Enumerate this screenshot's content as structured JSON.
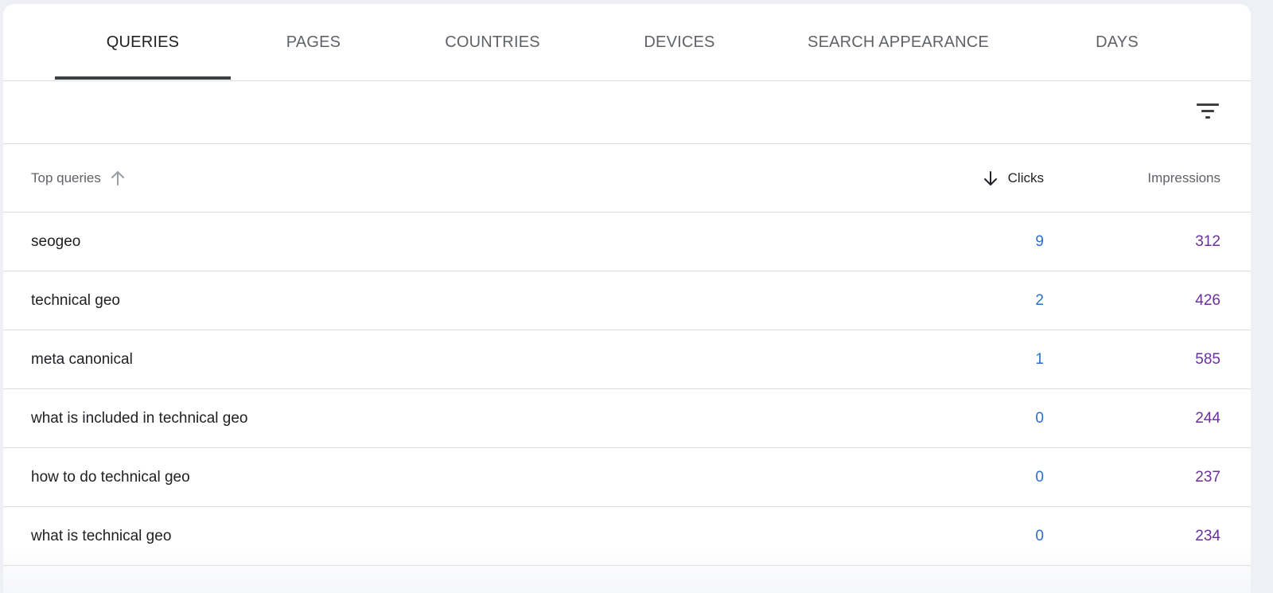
{
  "tabs": [
    {
      "label": "QUERIES",
      "active": true
    },
    {
      "label": "PAGES",
      "active": false
    },
    {
      "label": "COUNTRIES",
      "active": false
    },
    {
      "label": "DEVICES",
      "active": false
    },
    {
      "label": "SEARCH APPEARANCE",
      "active": false
    },
    {
      "label": "DAYS",
      "active": false
    }
  ],
  "toolbar": {
    "filter_icon": "filter-icon"
  },
  "table": {
    "columns": {
      "query": "Top queries",
      "clicks": "Clicks",
      "impressions": "Impressions"
    },
    "sort": {
      "query_icon": "arrow-up-icon",
      "clicks_icon": "arrow-down-icon"
    },
    "rows": [
      {
        "query": "seogeo",
        "clicks": "9",
        "impressions": "312"
      },
      {
        "query": "technical geo",
        "clicks": "2",
        "impressions": "426"
      },
      {
        "query": "meta canonical",
        "clicks": "1",
        "impressions": "585"
      },
      {
        "query": "what is included in technical geo",
        "clicks": "0",
        "impressions": "244"
      },
      {
        "query": "how to do technical geo",
        "clicks": "0",
        "impressions": "237"
      },
      {
        "query": "what is technical geo",
        "clicks": "0",
        "impressions": "234"
      }
    ]
  },
  "colors": {
    "clicks": "#2a6fd0",
    "impressions": "#6a2fa0",
    "active_tab_underline": "#3c4043"
  }
}
